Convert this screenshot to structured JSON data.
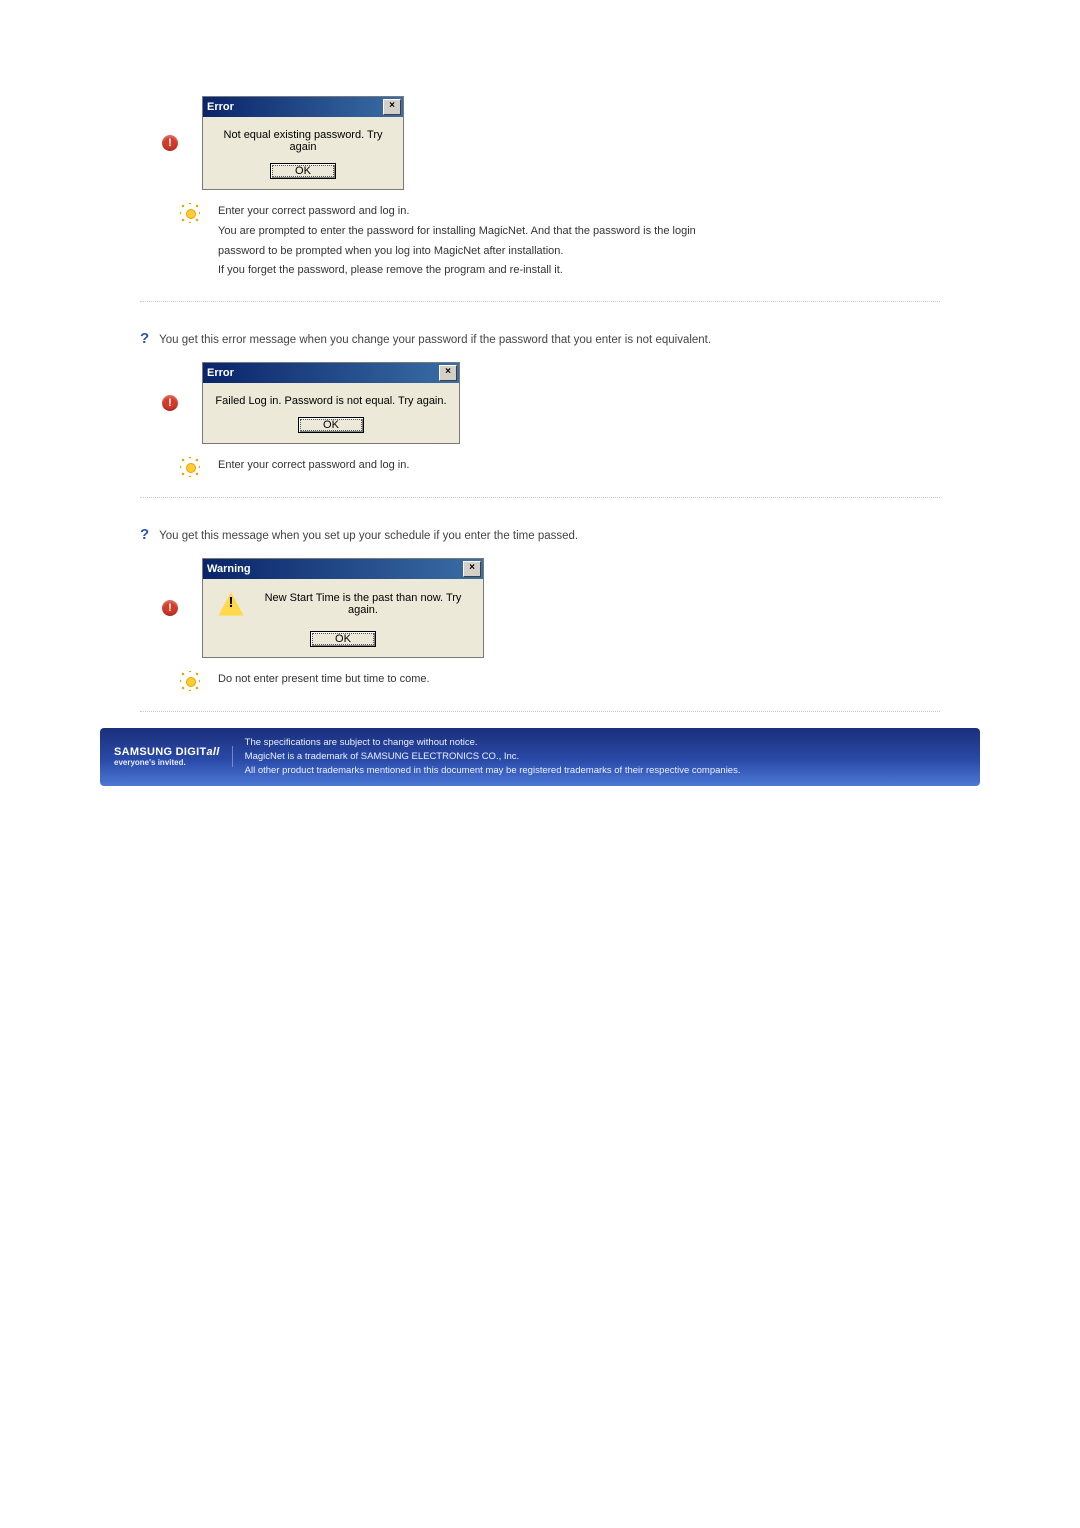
{
  "section1": {
    "dialog": {
      "title": "Error",
      "close": "×",
      "message": "Not equal existing password. Try again",
      "ok": "OK"
    },
    "tips": {
      "line1": "Enter your correct password and log in.",
      "line2": "You are prompted to enter the password for installing MagicNet. And that the password is the login",
      "line3": "password to be prompted when you log into MagicNet after installation.",
      "line4": "If you forget the password, please remove the program and re-install it."
    }
  },
  "section2": {
    "question": "You get this error message when you change your password if the password that you enter is not equivalent.",
    "dialog": {
      "title": "Error",
      "close": "×",
      "message": "Failed Log in. Password is not equal. Try again.",
      "ok": "OK"
    },
    "tip": "Enter your correct password and log in."
  },
  "section3": {
    "question": "You get this message when you set up your schedule if you enter the time passed.",
    "dialog": {
      "title": "Warning",
      "close": "×",
      "message": "New Start Time is the past than now. Try again.",
      "ok": "OK"
    },
    "tip": "Do not enter present time but time to come."
  },
  "footer": {
    "logoMain1": "SAMSUNG DIGIT",
    "logoMain2": "all",
    "logoSub": "everyone's invited.",
    "line1": "The specifications are subject to change without notice.",
    "line2": "MagicNet is a trademark of SAMSUNG ELECTRONICS CO., Inc.",
    "line3": "All other product trademarks mentioned in this document may be registered trademarks of their respective companies."
  }
}
